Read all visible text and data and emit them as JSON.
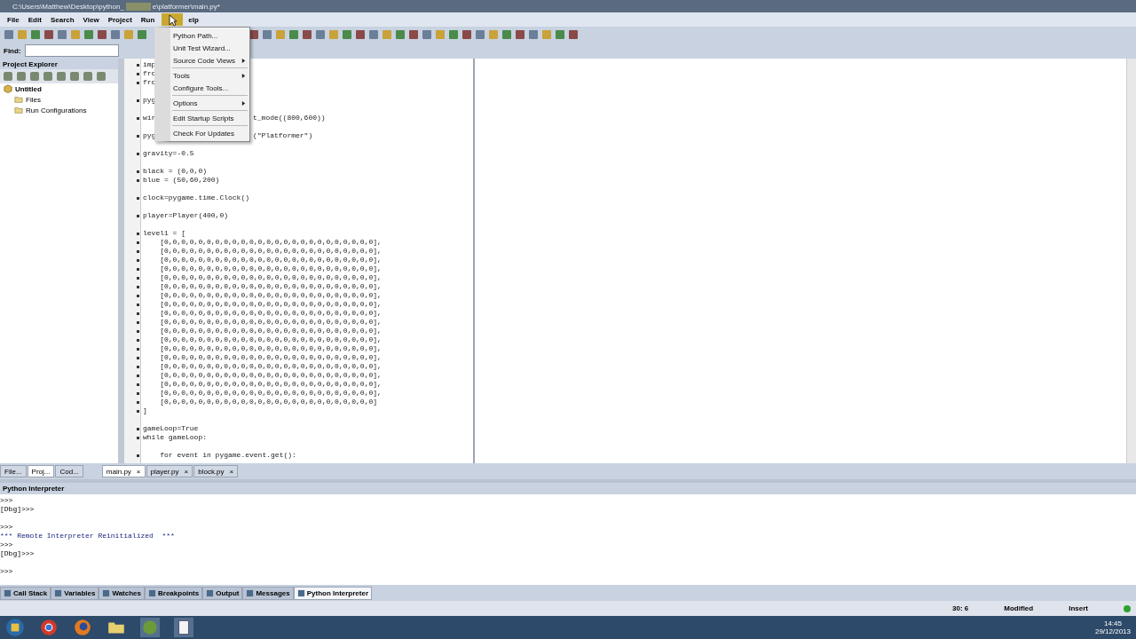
{
  "window": {
    "title_start": "C:\\Users\\Matthew\\Desktop\\python_",
    "title_end": "e\\platformer\\main.py*"
  },
  "menubar": [
    {
      "label": "File"
    },
    {
      "label": "Edit"
    },
    {
      "label": "Search"
    },
    {
      "label": "View"
    },
    {
      "label": "Project"
    },
    {
      "label": "Run"
    },
    {
      "label": "elp"
    }
  ],
  "menu": [
    [
      {
        "label": "Python Path...",
        "submenu": false
      },
      {
        "label": "Unit Test Wizard...",
        "submenu": false
      },
      {
        "label": "Source Code Views",
        "submenu": true
      }
    ],
    [
      {
        "label": "Tools",
        "submenu": true
      },
      {
        "label": "Configure Tools...",
        "submenu": false
      }
    ],
    [
      {
        "label": "Options",
        "submenu": true
      }
    ],
    [
      {
        "label": "Edit Startup Scripts",
        "submenu": false
      }
    ],
    [
      {
        "label": "Check For Updates",
        "submenu": false
      }
    ]
  ],
  "find": {
    "label": "Find:"
  },
  "project_explorer": {
    "title": "Project Explorer",
    "tree": [
      {
        "label": "Untitled",
        "children": [
          {
            "label": "Files"
          },
          {
            "label": "Run Configurations"
          }
        ]
      }
    ]
  },
  "code": [
    [
      {
        "text": "imp"
      },
      {
        "text": "fro"
      },
      {
        "text": "fro"
      }
    ],
    [
      {
        "text": "pyg"
      }
    ],
    [
      {
        "text": "wir",
        "after": "t_mode((800,600))"
      }
    ],
    [
      {
        "text": "pyg",
        "after": "(\"Platformer\")"
      }
    ],
    [
      {
        "text": "gravity=-0.5"
      }
    ],
    [
      {
        "text": "black = (0,0,0)"
      },
      {
        "text": "blue = (50,60,200)"
      }
    ],
    [
      {
        "text": "clock=pygame.time.Clock()"
      }
    ],
    [
      {
        "text": "player=Player(400,0)"
      }
    ],
    [
      {
        "text": "level1 = ["
      },
      {
        "text": "    [0,0,0,0,0,0,0,0,0,0,0,0,0,0,0,0,0,0,0,0,0,0,0,0,0],"
      },
      {
        "text": "    [0,0,0,0,0,0,0,0,0,0,0,0,0,0,0,0,0,0,0,0,0,0,0,0,0],"
      },
      {
        "text": "    [0,0,0,0,0,0,0,0,0,0,0,0,0,0,0,0,0,0,0,0,0,0,0,0,0],"
      },
      {
        "text": "    [0,0,0,0,0,0,0,0,0,0,0,0,0,0,0,0,0,0,0,0,0,0,0,0,0],"
      },
      {
        "text": "    [0,0,0,0,0,0,0,0,0,0,0,0,0,0,0,0,0,0,0,0,0,0,0,0,0],"
      },
      {
        "text": "    [0,0,0,0,0,0,0,0,0,0,0,0,0,0,0,0,0,0,0,0,0,0,0,0,0],"
      },
      {
        "text": "    [0,0,0,0,0,0,0,0,0,0,0,0,0,0,0,0,0,0,0,0,0,0,0,0,0],"
      },
      {
        "text": "    [0,0,0,0,0,0,0,0,0,0,0,0,0,0,0,0,0,0,0,0,0,0,0,0,0],"
      },
      {
        "text": "    [0,0,0,0,0,0,0,0,0,0,0,0,0,0,0,0,0,0,0,0,0,0,0,0,0],"
      },
      {
        "text": "    [0,0,0,0,0,0,0,0,0,0,0,0,0,0,0,0,0,0,0,0,0,0,0,0,0],"
      },
      {
        "text": "    [0,0,0,0,0,0,0,0,0,0,0,0,0,0,0,0,0,0,0,0,0,0,0,0,0],"
      },
      {
        "text": "    [0,0,0,0,0,0,0,0,0,0,0,0,0,0,0,0,0,0,0,0,0,0,0,0,0],"
      },
      {
        "text": "    [0,0,0,0,0,0,0,0,0,0,0,0,0,0,0,0,0,0,0,0,0,0,0,0,0],"
      },
      {
        "text": "    [0,0,0,0,0,0,0,0,0,0,0,0,0,0,0,0,0,0,0,0,0,0,0,0,0],"
      },
      {
        "text": "    [0,0,0,0,0,0,0,0,0,0,0,0,0,0,0,0,0,0,0,0,0,0,0,0,0],"
      },
      {
        "text": "    [0,0,0,0,0,0,0,0,0,0,0,0,0,0,0,0,0,0,0,0,0,0,0,0,0],"
      },
      {
        "text": "    [0,0,0,0,0,0,0,0,0,0,0,0,0,0,0,0,0,0,0,0,0,0,0,0,0],"
      },
      {
        "text": "    [0,0,0,0,0,0,0,0,0,0,0,0,0,0,0,0,0,0,0,0,0,0,0,0,0],"
      },
      {
        "text": "    [0,0,0,0,0,0,0,0,0,0,0,0,0,0,0,0,0,0,0,0,0,0,0,0,0]"
      },
      {
        "text": "]"
      }
    ],
    [
      {
        "text": "gameLoop=True"
      },
      {
        "text": "while gameLoop:"
      }
    ],
    [
      {
        "text": "    for event in pygame.event.get():"
      }
    ]
  ],
  "left_tabs": [
    {
      "label": "File...",
      "selected": false
    },
    {
      "label": "Proj...",
      "selected": true
    },
    {
      "label": "Cod...",
      "selected": false
    }
  ],
  "editor_tabs": [
    {
      "label": "main.py",
      "close": "×",
      "selected": true
    },
    {
      "label": "player.py",
      "close": "×",
      "selected": false
    },
    {
      "label": "block.py",
      "close": "×",
      "selected": false
    }
  ],
  "interpreter": {
    "title": "Python Interpreter",
    "groups": [
      [
        {
          "text": ">>>",
          "kind": "prompt"
        },
        {
          "text": "[Dbg]>>>",
          "kind": "prompt"
        }
      ],
      [
        {
          "text": ">>>",
          "kind": "prompt"
        },
        {
          "text": "*** Remote Interpreter Reinitialized  ***",
          "kind": "message"
        },
        {
          "text": ">>>",
          "kind": "prompt"
        },
        {
          "text": "[Dbg]>>>",
          "kind": "prompt"
        }
      ],
      [
        {
          "text": ">>>",
          "kind": "prompt"
        }
      ]
    ]
  },
  "bottom_tabs": [
    {
      "label": "Call Stack",
      "selected": false
    },
    {
      "label": "Variables",
      "selected": false
    },
    {
      "label": "Watches",
      "selected": false
    },
    {
      "label": "Breakpoints",
      "selected": false
    },
    {
      "label": "Output",
      "selected": false
    },
    {
      "label": "Messages",
      "selected": false
    },
    {
      "label": "Python Interpreter",
      "selected": true
    }
  ],
  "status_bar": {
    "position": "30: 6",
    "modified": "Modified",
    "mode": "Insert"
  },
  "taskbar": {
    "time": "14:45",
    "date": "29/12/2013"
  }
}
